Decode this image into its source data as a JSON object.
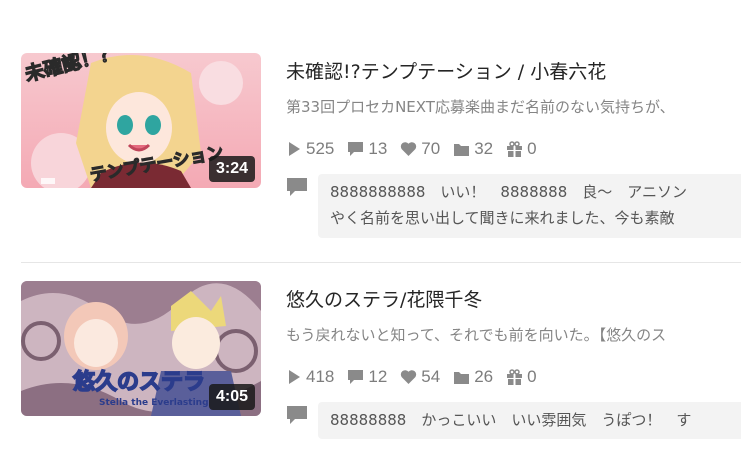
{
  "videos": [
    {
      "title": "未確認!?テンプテーション / 小春六花",
      "description": "第33回プロセカNEXT応募楽曲まだ名前のない気持ちが、",
      "duration": "3:24",
      "thumb_text_top": "未確認！？",
      "thumb_text_bottom": "テンプテーション",
      "stats": {
        "views": "525",
        "comments": "13",
        "likes": "70",
        "mylists": "32",
        "gifts": "0"
      },
      "comment_lines": [
        "8888888888　いい！　8888888　良～　アニソン",
        "やく名前を思い出して聞きに来れました、今も素敵"
      ]
    },
    {
      "title": "悠久のステラ/花隈千冬",
      "description": "もう戻れないと知って、それでも前を向いた。【悠久のス",
      "duration": "4:05",
      "thumb_text_top": "悠久のステラ",
      "thumb_text_bottom": "Stella the Everlasting",
      "stats": {
        "views": "418",
        "comments": "12",
        "likes": "54",
        "mylists": "26",
        "gifts": "0"
      },
      "comment_lines": [
        "88888888　かっこいい　いい雰囲気　うぽつ！　す"
      ]
    }
  ],
  "icons": {
    "views": "play-icon",
    "comments": "comment-icon",
    "likes": "heart-icon",
    "mylists": "folder-icon",
    "gifts": "gift-icon",
    "comment_preview": "comment-preview-icon"
  },
  "colors": {
    "text": "#252525",
    "muted": "#858585",
    "icon": "#8a8a8a",
    "comment_bg": "#f3f3f3"
  }
}
